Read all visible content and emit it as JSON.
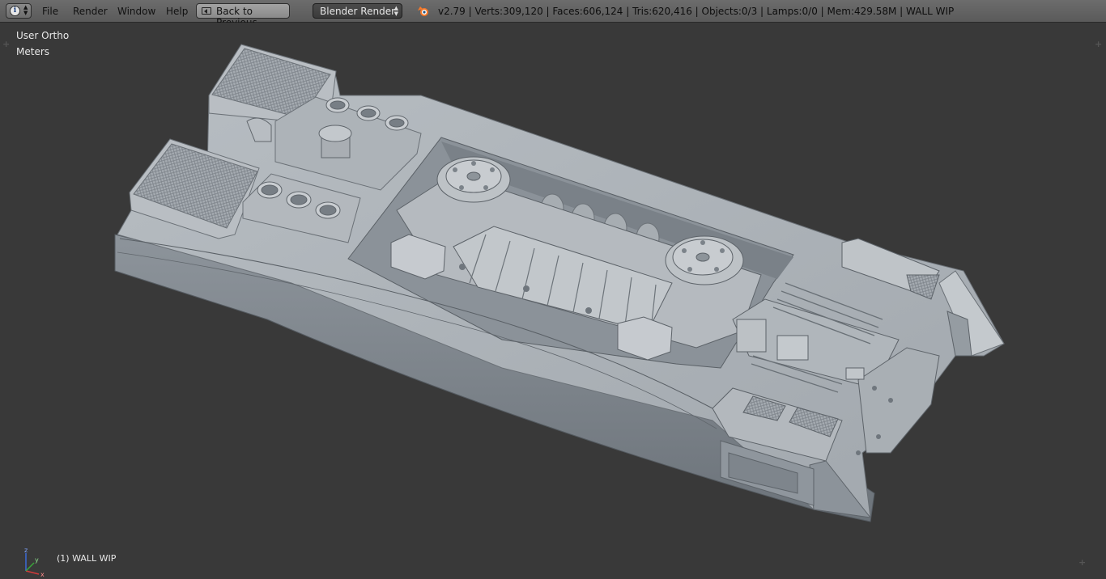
{
  "topbar": {
    "editor_type_icon": "info-icon",
    "menus": [
      "File",
      "Render",
      "Window",
      "Help"
    ],
    "back_button_label": "Back to Previous",
    "render_engine": "Blender Render",
    "stats": "v2.79 | Verts:309,120 | Faces:606,124 | Tris:620,416 | Objects:0/3 | Lamps:0/0 | Mem:429.58M | WALL WIP"
  },
  "viewport": {
    "view_name": "User Ortho",
    "units": "Meters",
    "object_info": "(1) WALL WIP",
    "axis_labels": {
      "x": "x",
      "y": "y",
      "z": "z"
    },
    "background_color": "#393939",
    "model_color": "#9aa0a6"
  }
}
